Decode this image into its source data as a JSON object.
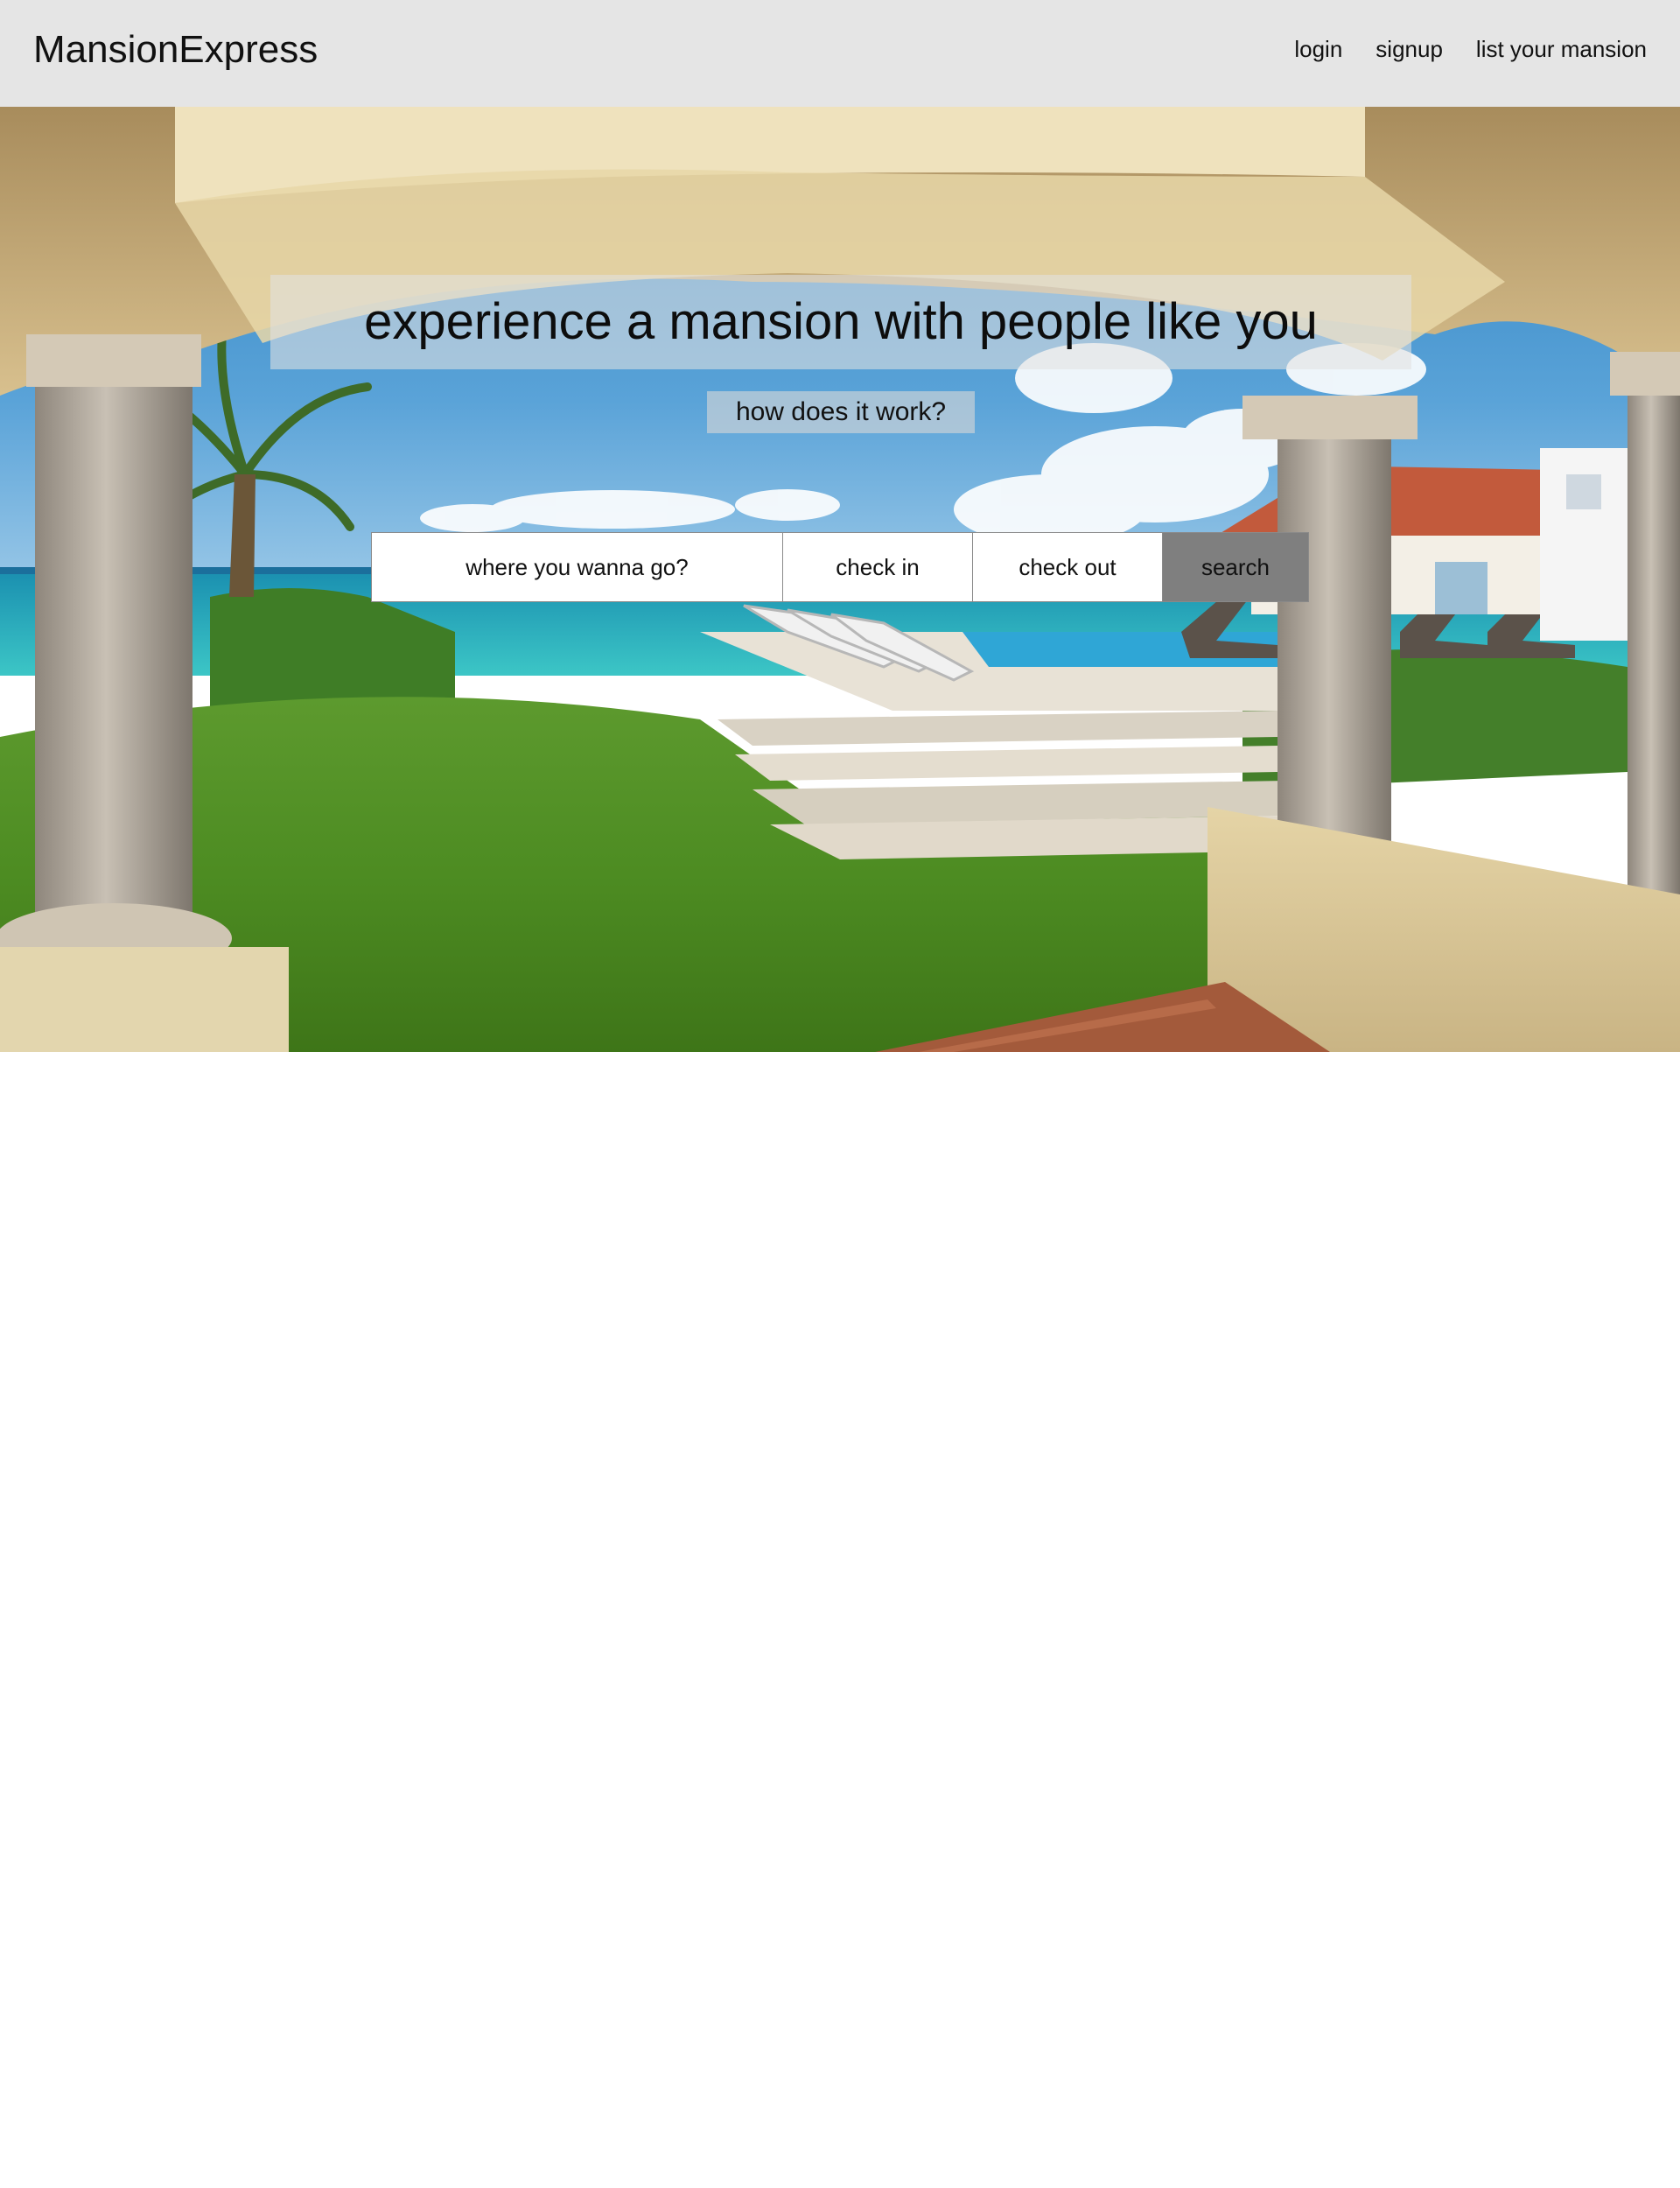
{
  "header": {
    "brand": "MansionExpress",
    "links": [
      {
        "label": "login"
      },
      {
        "label": "signup"
      },
      {
        "label": "list your mansion"
      }
    ]
  },
  "hero": {
    "image": "beachfront-mansion-veranda-photo",
    "headline": "experience a mansion with people like you",
    "how_it_works": "how does it work?"
  },
  "search": {
    "destination_placeholder": "where you wanna go?",
    "checkin_placeholder": "check in",
    "checkout_placeholder": "check out",
    "search_label": "search"
  },
  "colors": {
    "navbar": "#e5e5e5",
    "search_button": "#7f7f7f",
    "band": "#e1e1e1"
  }
}
